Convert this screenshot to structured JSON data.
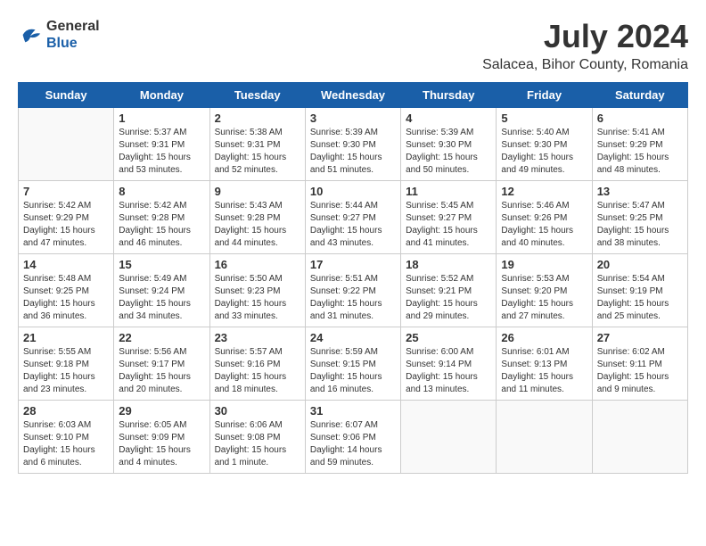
{
  "logo": {
    "general": "General",
    "blue": "Blue"
  },
  "title": {
    "month_year": "July 2024",
    "location": "Salacea, Bihor County, Romania"
  },
  "headers": [
    "Sunday",
    "Monday",
    "Tuesday",
    "Wednesday",
    "Thursday",
    "Friday",
    "Saturday"
  ],
  "weeks": [
    [
      {
        "day": "",
        "info": ""
      },
      {
        "day": "1",
        "info": "Sunrise: 5:37 AM\nSunset: 9:31 PM\nDaylight: 15 hours\nand 53 minutes."
      },
      {
        "day": "2",
        "info": "Sunrise: 5:38 AM\nSunset: 9:31 PM\nDaylight: 15 hours\nand 52 minutes."
      },
      {
        "day": "3",
        "info": "Sunrise: 5:39 AM\nSunset: 9:30 PM\nDaylight: 15 hours\nand 51 minutes."
      },
      {
        "day": "4",
        "info": "Sunrise: 5:39 AM\nSunset: 9:30 PM\nDaylight: 15 hours\nand 50 minutes."
      },
      {
        "day": "5",
        "info": "Sunrise: 5:40 AM\nSunset: 9:30 PM\nDaylight: 15 hours\nand 49 minutes."
      },
      {
        "day": "6",
        "info": "Sunrise: 5:41 AM\nSunset: 9:29 PM\nDaylight: 15 hours\nand 48 minutes."
      }
    ],
    [
      {
        "day": "7",
        "info": "Sunrise: 5:42 AM\nSunset: 9:29 PM\nDaylight: 15 hours\nand 47 minutes."
      },
      {
        "day": "8",
        "info": "Sunrise: 5:42 AM\nSunset: 9:28 PM\nDaylight: 15 hours\nand 46 minutes."
      },
      {
        "day": "9",
        "info": "Sunrise: 5:43 AM\nSunset: 9:28 PM\nDaylight: 15 hours\nand 44 minutes."
      },
      {
        "day": "10",
        "info": "Sunrise: 5:44 AM\nSunset: 9:27 PM\nDaylight: 15 hours\nand 43 minutes."
      },
      {
        "day": "11",
        "info": "Sunrise: 5:45 AM\nSunset: 9:27 PM\nDaylight: 15 hours\nand 41 minutes."
      },
      {
        "day": "12",
        "info": "Sunrise: 5:46 AM\nSunset: 9:26 PM\nDaylight: 15 hours\nand 40 minutes."
      },
      {
        "day": "13",
        "info": "Sunrise: 5:47 AM\nSunset: 9:25 PM\nDaylight: 15 hours\nand 38 minutes."
      }
    ],
    [
      {
        "day": "14",
        "info": "Sunrise: 5:48 AM\nSunset: 9:25 PM\nDaylight: 15 hours\nand 36 minutes."
      },
      {
        "day": "15",
        "info": "Sunrise: 5:49 AM\nSunset: 9:24 PM\nDaylight: 15 hours\nand 34 minutes."
      },
      {
        "day": "16",
        "info": "Sunrise: 5:50 AM\nSunset: 9:23 PM\nDaylight: 15 hours\nand 33 minutes."
      },
      {
        "day": "17",
        "info": "Sunrise: 5:51 AM\nSunset: 9:22 PM\nDaylight: 15 hours\nand 31 minutes."
      },
      {
        "day": "18",
        "info": "Sunrise: 5:52 AM\nSunset: 9:21 PM\nDaylight: 15 hours\nand 29 minutes."
      },
      {
        "day": "19",
        "info": "Sunrise: 5:53 AM\nSunset: 9:20 PM\nDaylight: 15 hours\nand 27 minutes."
      },
      {
        "day": "20",
        "info": "Sunrise: 5:54 AM\nSunset: 9:19 PM\nDaylight: 15 hours\nand 25 minutes."
      }
    ],
    [
      {
        "day": "21",
        "info": "Sunrise: 5:55 AM\nSunset: 9:18 PM\nDaylight: 15 hours\nand 23 minutes."
      },
      {
        "day": "22",
        "info": "Sunrise: 5:56 AM\nSunset: 9:17 PM\nDaylight: 15 hours\nand 20 minutes."
      },
      {
        "day": "23",
        "info": "Sunrise: 5:57 AM\nSunset: 9:16 PM\nDaylight: 15 hours\nand 18 minutes."
      },
      {
        "day": "24",
        "info": "Sunrise: 5:59 AM\nSunset: 9:15 PM\nDaylight: 15 hours\nand 16 minutes."
      },
      {
        "day": "25",
        "info": "Sunrise: 6:00 AM\nSunset: 9:14 PM\nDaylight: 15 hours\nand 13 minutes."
      },
      {
        "day": "26",
        "info": "Sunrise: 6:01 AM\nSunset: 9:13 PM\nDaylight: 15 hours\nand 11 minutes."
      },
      {
        "day": "27",
        "info": "Sunrise: 6:02 AM\nSunset: 9:11 PM\nDaylight: 15 hours\nand 9 minutes."
      }
    ],
    [
      {
        "day": "28",
        "info": "Sunrise: 6:03 AM\nSunset: 9:10 PM\nDaylight: 15 hours\nand 6 minutes."
      },
      {
        "day": "29",
        "info": "Sunrise: 6:05 AM\nSunset: 9:09 PM\nDaylight: 15 hours\nand 4 minutes."
      },
      {
        "day": "30",
        "info": "Sunrise: 6:06 AM\nSunset: 9:08 PM\nDaylight: 15 hours\nand 1 minute."
      },
      {
        "day": "31",
        "info": "Sunrise: 6:07 AM\nSunset: 9:06 PM\nDaylight: 14 hours\nand 59 minutes."
      },
      {
        "day": "",
        "info": ""
      },
      {
        "day": "",
        "info": ""
      },
      {
        "day": "",
        "info": ""
      }
    ]
  ]
}
